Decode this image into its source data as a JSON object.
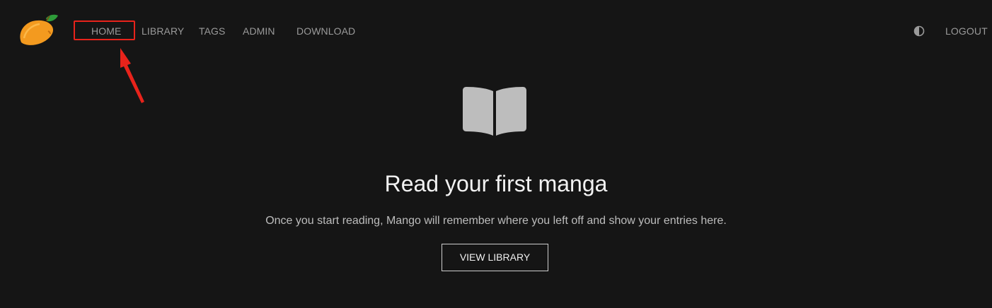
{
  "nav": {
    "items": [
      {
        "label": "HOME"
      },
      {
        "label": "LIBRARY"
      },
      {
        "label": "TAGS"
      },
      {
        "label": "ADMIN"
      },
      {
        "label": "DOWNLOAD"
      }
    ],
    "logout_label": "LOGOUT",
    "theme_toggle_icon": "contrast-half-circle-icon",
    "logo_icon": "mango-logo-icon"
  },
  "empty_state": {
    "icon": "open-book-icon",
    "title": "Read your first manga",
    "description": "Once you start reading, Mango will remember where you left off and show your entries here.",
    "button_label": "VIEW LIBRARY"
  },
  "annotation": {
    "highlight_color": "#e8231b",
    "target": "HOME"
  },
  "colors": {
    "background": "#151515",
    "nav_text": "#9a9a9a",
    "icon_gray": "#bdbdbd",
    "logo_orange": "#f39a1f",
    "logo_leaf": "#2e9c3a"
  }
}
